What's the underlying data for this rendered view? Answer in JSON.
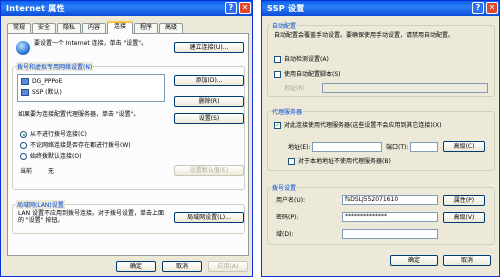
{
  "left_window": {
    "title": "Internet 属性",
    "tabs": [
      "常规",
      "安全",
      "隐私",
      "内容",
      "连接",
      "程序",
      "高级"
    ],
    "active_tab": "连接",
    "setup_text": "要设置一个 Internet 连接，单击 \"设置\"。",
    "setup_button": "建立连接(U)...",
    "dialup_group": "拨号和虚拟专用网络设置(N)",
    "connections": [
      "DG_PPPoE",
      "SSP (默认)"
    ],
    "add_button": "添加(D)...",
    "remove_button": "删除(R)",
    "settings_button": "设置(S)",
    "proxy_text": "如果要为连接配置代理服务器，单击 \"设置\"。",
    "radio_options": [
      {
        "label": "从不进行拨号连接(C)",
        "checked": true
      },
      {
        "label": "不论网络连接是否存在都进行拨号(W)",
        "checked": false
      },
      {
        "label": "始终拨默认连接(O)",
        "checked": false
      }
    ],
    "current_label": "当前",
    "current_value": "无",
    "set_default_button": "设置默认值(E)",
    "lan_group": "局域网(LAN)设置",
    "lan_text": "LAN 设置不应用到拨号连接。对于拨号设置，单击上面的 \"设置\" 按钮。",
    "lan_button": "局域网设置(L)...",
    "ok_button": "确定",
    "cancel_button": "取消",
    "apply_button": "应用(A)"
  },
  "right_window": {
    "title": "SSP 设置",
    "autoconfig_group": "自动配置",
    "autoconfig_text": "自动配置会覆盖手动设置。要确保使用手动设置，请禁用自动配置。",
    "auto_detect": {
      "label": "自动检测设置(A)",
      "checked": false
    },
    "auto_script": {
      "label": "使用自动配置脚本(S)",
      "checked": false
    },
    "address_label": "地址(R)",
    "proxy_group": "代理服务器",
    "use_proxy": {
      "label": "对此连接使用代理服务器(这些设置不会应用到其它连接)(X)",
      "checked": true
    },
    "proxy_address_label": "地址(E):",
    "port_label": "端口(T):",
    "advanced_button": "高级(C)",
    "bypass_local": {
      "label": "对于本地地址不使用代理服务器(B)",
      "checked": false
    },
    "dialup_group": "拨号设置",
    "username_label": "用户名(U):",
    "username_value": "fsDSLJ552071610",
    "password_label": "密码(P):",
    "password_value": "**************",
    "domain_label": "域(D):",
    "domain_value": "",
    "properties_button": "属性(P)",
    "advanced2_button": "高级(V)",
    "ok_button": "确定",
    "cancel_button": "取消"
  }
}
